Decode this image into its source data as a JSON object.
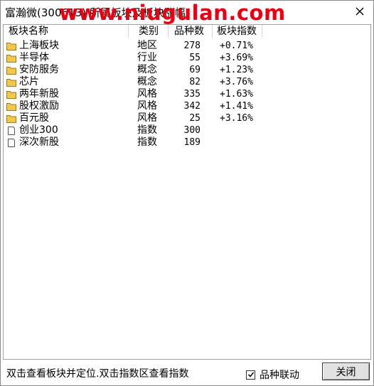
{
  "window": {
    "title": "富瀚微(300613) 所属板块及板块涨幅",
    "watermark": "www.niugulan.com"
  },
  "table": {
    "headers": [
      "板块名称",
      "类别",
      "品种数",
      "板块指数"
    ],
    "rows": [
      {
        "name": "上海板块",
        "type": "地区",
        "count": "278",
        "change": "+0.71%",
        "icon": "folder-icon"
      },
      {
        "name": "半导体",
        "type": "行业",
        "count": "55",
        "change": "+3.69%",
        "icon": "folder-icon"
      },
      {
        "name": "安防服务",
        "type": "概念",
        "count": "69",
        "change": "+1.23%",
        "icon": "folder-icon"
      },
      {
        "name": "芯片",
        "type": "概念",
        "count": "82",
        "change": "+3.76%",
        "icon": "folder-icon"
      },
      {
        "name": "两年新股",
        "type": "风格",
        "count": "335",
        "change": "+1.63%",
        "icon": "folder-icon"
      },
      {
        "name": "股权激励",
        "type": "风格",
        "count": "342",
        "change": "+1.41%",
        "icon": "folder-icon"
      },
      {
        "name": "百元股",
        "type": "风格",
        "count": "25",
        "change": "+3.16%",
        "icon": "folder-icon"
      },
      {
        "name": "创业300",
        "type": "指数",
        "count": "300",
        "change": "",
        "icon": "document-icon"
      },
      {
        "name": "深次新股",
        "type": "指数",
        "count": "189",
        "change": "",
        "icon": "document-icon"
      }
    ]
  },
  "footer": {
    "hint": "双击查看板块并定位.双击指数区查看指数",
    "link_label": "品种联动",
    "link_checked": true,
    "close_label": "关闭"
  },
  "colors": {
    "folder": "#f3c84a",
    "watermark": "#e60012"
  }
}
